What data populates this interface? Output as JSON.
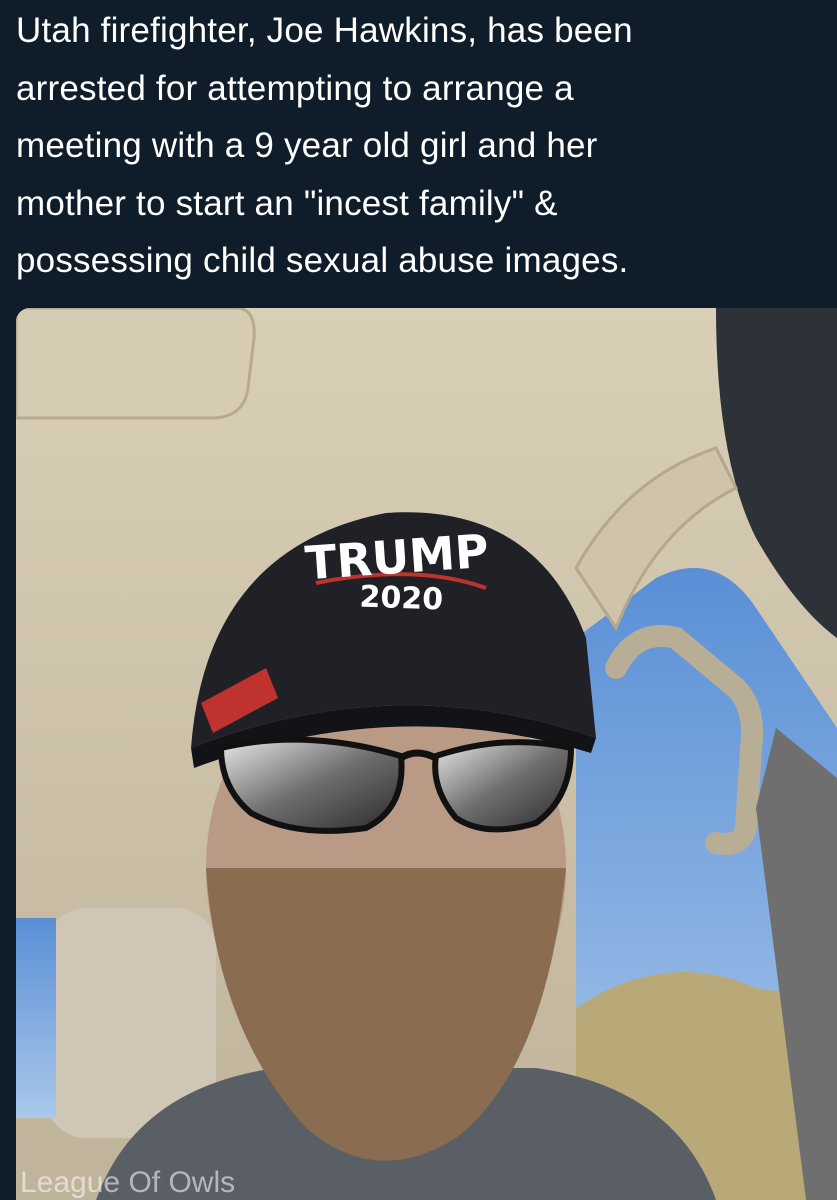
{
  "post": {
    "caption_lines": [
      "Utah firefighter, Joe Hawkins, has been",
      "arrested for attempting to arrange a",
      "meeting with a 9 year old girl and her",
      "mother to start an \"incest family\" &",
      "possessing child sexual abuse images."
    ],
    "photo": {
      "hat_text_top": "TRUMP",
      "hat_text_year": "2020",
      "watermark": "League Of Owls"
    },
    "colors": {
      "background": "#0f1d2a",
      "caption_text": "#ffffff",
      "hat_red": "#c0322d"
    }
  }
}
